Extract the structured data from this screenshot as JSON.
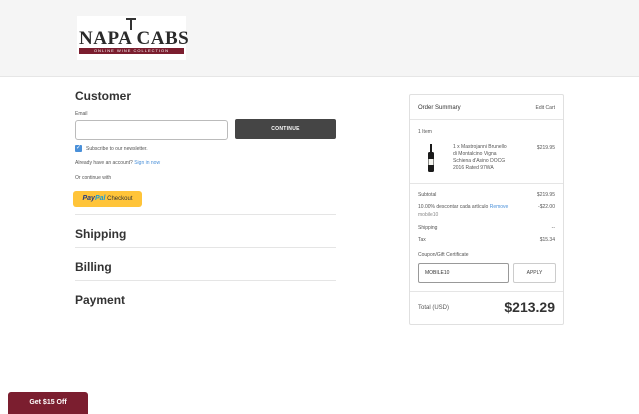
{
  "logo": {
    "text": "NAPA CABS",
    "tagline": "ONLINE WINE COLLECTION"
  },
  "customer": {
    "title": "Customer",
    "email_label": "Email",
    "email_value": "",
    "continue_label": "CONTINUE",
    "newsletter_label": "Subscribe to our newsletter.",
    "newsletter_checked": true,
    "account_prompt": "Already have an account?",
    "sign_in_label": "Sign in now",
    "or_continue": "Or continue with",
    "paypal_brand_a": "Pay",
    "paypal_brand_b": "Pal",
    "paypal_checkout": "Checkout"
  },
  "sections": {
    "shipping": "Shipping",
    "billing": "Billing",
    "payment": "Payment"
  },
  "summary": {
    "title": "Order Summary",
    "edit_cart": "Edit Cart",
    "item_count": "1 Item",
    "item_name_lines": [
      "1 x Mastrojanni Brunello",
      "di Montalcino Vigna",
      "Schiena d'Asino DOCG",
      "2016 Rated 97WA"
    ],
    "item_price": "$219.95",
    "subtotal_label": "Subtotal",
    "subtotal_value": "$219.95",
    "discount_label": "10.00% descontar cada artículo",
    "discount_remove": "Remove",
    "discount_code": "mobile10",
    "discount_value": "-$22.00",
    "shipping_label": "Shipping",
    "shipping_value": "--",
    "tax_label": "Tax",
    "tax_value": "$15.34",
    "coupon_label": "Coupon/Gift Certificate",
    "coupon_value": "MOBILE10",
    "apply_label": "APPLY",
    "total_label": "Total (USD)",
    "total_value": "$213.29"
  },
  "promo": {
    "label": "Get $15 Off"
  },
  "colors": {
    "accent": "#4a90d9",
    "brand": "#7b1e2f",
    "paypal": "#ffc439"
  }
}
